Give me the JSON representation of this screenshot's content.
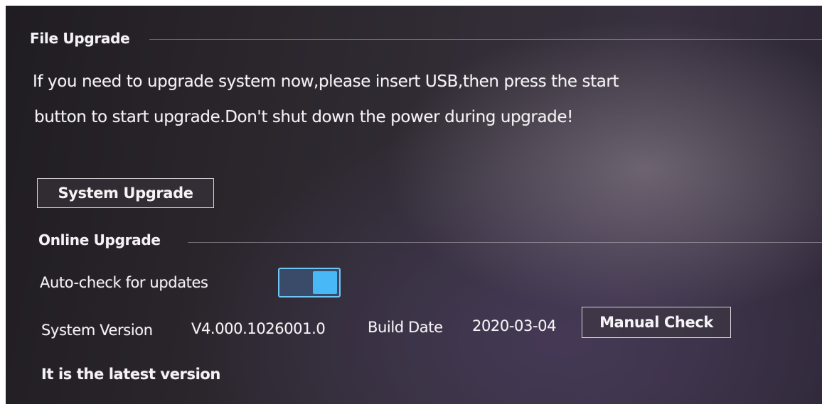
{
  "file_upgrade": {
    "title": "File Upgrade",
    "notice_line1": "If you need to upgrade system now,please insert USB,then press the start",
    "notice_line2": "button to start upgrade.Don't shut down the power during upgrade!",
    "system_upgrade_label": "System Upgrade"
  },
  "online_upgrade": {
    "title": "Online Upgrade",
    "auto_check_label": "Auto-check for updates",
    "auto_check_enabled": true,
    "version_label": "System Version",
    "version_value": "V4.000.1026001.0",
    "build_date_label": "Build Date",
    "build_date_value": "2020-03-04",
    "manual_check_label": "Manual Check",
    "status_text": "It is the latest version"
  },
  "colors": {
    "toggle_on": "#48b8f6",
    "text": "#f4f2f5"
  }
}
